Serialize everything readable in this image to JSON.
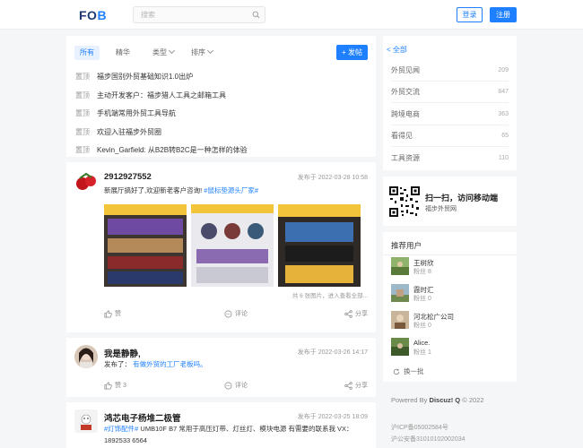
{
  "header": {
    "logo_text": "FOB",
    "search_placeholder": "搜索",
    "login_label": "登录",
    "register_label": "注册",
    "accent_color": "#1e80ff"
  },
  "filter": {
    "tabs": [
      "所有",
      "精华",
      "类型",
      "排序"
    ],
    "post_button": "+ 发帖"
  },
  "pinned": [
    {
      "tag": "置顶",
      "title": "福步国别外贸基础知识1.0出炉"
    },
    {
      "tag": "置顶",
      "title": "主动开发客户：福步猎人工具之邮箱工具"
    },
    {
      "tag": "置顶",
      "title": "手机端常用外贸工具导航"
    },
    {
      "tag": "置顶",
      "title": "欢迎入驻福步外贸圈"
    },
    {
      "tag": "置顶",
      "title": "Kevin_Garfield: 从B2B转B2C是一种怎样的体验"
    }
  ],
  "posts": [
    {
      "user": "2912927552",
      "time": "发布于 2022-03-28 10:58",
      "text": "新展厅搞好了,欢迎新老客户咨询! ",
      "tag": "#鼠标垫源头厂家#",
      "image_count_text": "共 6 张图片，进入查看全部...",
      "like": "赞",
      "comment": "评论",
      "share": "分享"
    },
    {
      "user": "我是静静,",
      "time": "发布于 2022-03-26 14:17",
      "text": "发布了： ",
      "link": "有做外贸的工厂老板吗。",
      "like": "赞 3",
      "comment": "评论",
      "share": "分享"
    },
    {
      "user": "鸿芯电子杨堆二极管",
      "time": "发布于 2022-03-25 18:09",
      "tag": "#灯饰配件#",
      "text": " UMB10F B7 常用于高压灯带、灯丝灯、模块电源 有需要的联系我 VX：1892533 6564"
    }
  ],
  "categories": {
    "back": "< 全部",
    "items": [
      {
        "name": "外贸见闻",
        "count": "209"
      },
      {
        "name": "外贸交流",
        "count": "847"
      },
      {
        "name": "跨境电商",
        "count": "363"
      },
      {
        "name": "看得见",
        "count": "65"
      },
      {
        "name": "工具资源",
        "count": "110"
      }
    ]
  },
  "mobile": {
    "title": "扫一扫，访问移动端",
    "subtitle": "福步外贸网"
  },
  "recommended": {
    "title": "推荐用户",
    "users": [
      {
        "name": "王树欣",
        "fans": "粉丝 8"
      },
      {
        "name": "霞时汇",
        "fans": "粉丝 0"
      },
      {
        "name": "河北松广公司",
        "fans": "粉丝 0"
      },
      {
        "name": "Alice.",
        "fans": "粉丝 1"
      }
    ],
    "refresh": "换一批"
  },
  "footer": {
    "powered_prefix": "Powered By",
    "powered_brand": "Discuz! Q",
    "powered_suffix": "© 2022",
    "icp1": "沪ICP备05002584号",
    "icp2": "沪公安备31010102002034"
  }
}
